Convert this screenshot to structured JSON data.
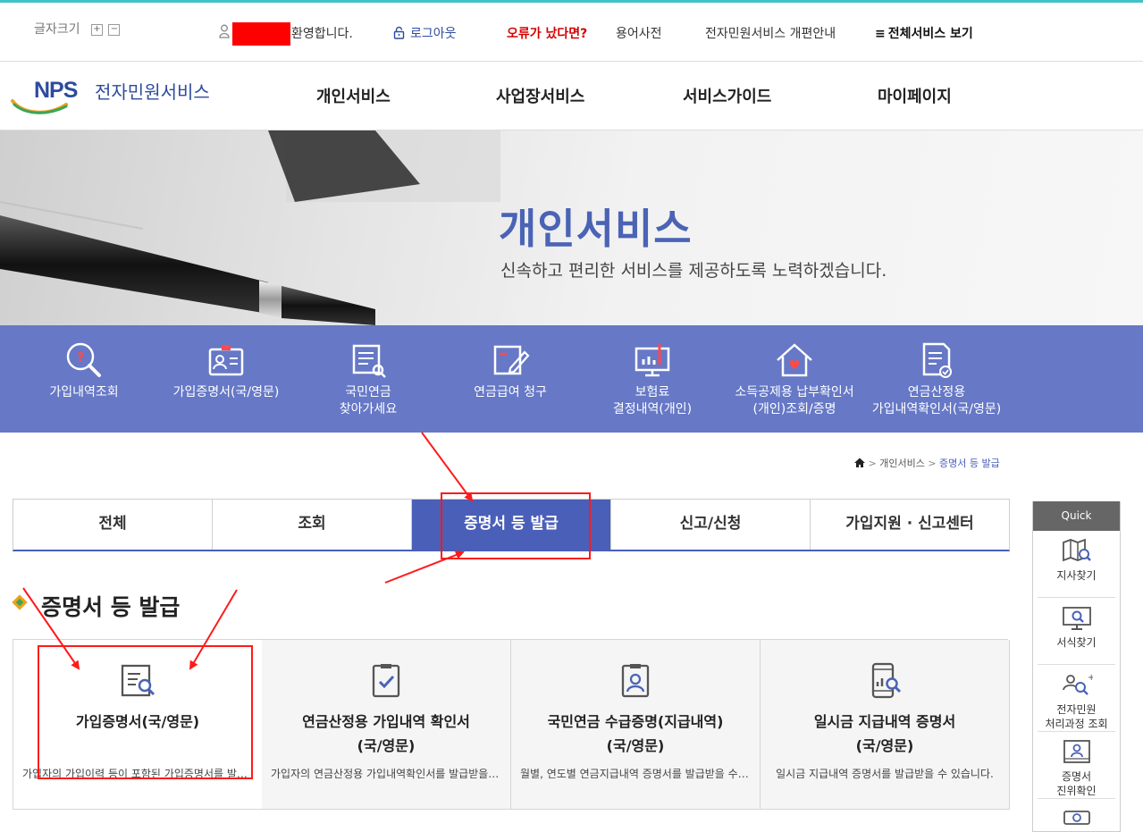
{
  "util": {
    "font_size_label": "글자크기",
    "font_plus": "+",
    "font_minus": "−",
    "welcome": "환영합니다.",
    "logout": "로그아웃",
    "error": "오류가 났다면?",
    "glossary": "용어사전",
    "renewal": "전자민원서비스 개편안내",
    "all_services": "전체서비스 보기",
    "hamburger": "≡"
  },
  "logo": {
    "mark": "NPS",
    "name": "전자민원서비스"
  },
  "nav": [
    "개인서비스",
    "사업장서비스",
    "서비스가이드",
    "마이페이지"
  ],
  "hero": {
    "title": "개인서비스",
    "subtitle": "신속하고 편리한 서비스를 제공하도록 노력하겠습니다."
  },
  "services": [
    {
      "line1": "가입내역조회",
      "line2": "",
      "icon": "search-question-icon"
    },
    {
      "line1": "가입증명서(국/영문)",
      "line2": "",
      "icon": "id-card-icon"
    },
    {
      "line1": "국민연금",
      "line2": "찾아가세요",
      "icon": "document-search-icon"
    },
    {
      "line1": "연금급여 청구",
      "line2": "",
      "icon": "edit-document-icon"
    },
    {
      "line1": "보험료",
      "line2": "결정내역(개인)",
      "icon": "monitor-chart-icon"
    },
    {
      "line1": "소득공제용 납부확인서",
      "line2": "(개인)조회/증명",
      "icon": "house-heart-icon"
    },
    {
      "line1": "연금산정용",
      "line2": "가입내역확인서(국/영문)",
      "icon": "document-check-icon"
    }
  ],
  "breadcrumb": {
    "level1": "개인서비스",
    "level2": "증명서 등 발급",
    "sep": ">"
  },
  "tabs": [
    {
      "label": "전체",
      "active": false
    },
    {
      "label": "조회",
      "active": false
    },
    {
      "label": "증명서 등 발급",
      "active": true
    },
    {
      "label": "신고/신청",
      "active": false
    },
    {
      "label": "가입지원 · 신고센터",
      "active": false
    }
  ],
  "section_title": "증명서 등 발급",
  "cards": [
    {
      "title1": "가입증명서(국/영문)",
      "title2": "",
      "desc": "가입자의 가입이력 등이 포함된 가입증명서를 발급받을 수 있습니다.",
      "icon": "document-search-icon"
    },
    {
      "title1": "연금산정용 가입내역 확인서",
      "title2": "(국/영문)",
      "desc": "가입자의 연금산정용 가입내역확인서를 발급받을 수 있습니다.",
      "icon": "clipboard-check-icon"
    },
    {
      "title1": "국민연금 수급증명(지급내역)",
      "title2": "(국/영문)",
      "desc": "월별, 연도별 연금지급내역 증명서를 발급받을 수 있습니다.",
      "icon": "id-badge-icon"
    },
    {
      "title1": "일시금 지급내역 증명서",
      "title2": "(국/영문)",
      "desc": "일시금 지급내역 증명서를 발급받을 수 있습니다.",
      "icon": "mobile-chart-icon"
    }
  ],
  "quick": {
    "title": "Quick",
    "items": [
      {
        "line1": "지사찾기",
        "line2": "",
        "icon": "map-search-icon"
      },
      {
        "line1": "서식찾기",
        "line2": "",
        "icon": "monitor-search-icon"
      },
      {
        "line1": "전자민원",
        "line2": "처리과정 조회",
        "icon": "people-search-icon"
      },
      {
        "line1": "증명서",
        "line2": "진위확인",
        "icon": "certificate-icon"
      },
      {
        "line1": "",
        "line2": "",
        "icon": "scanner-icon"
      }
    ]
  },
  "colors": {
    "band": "#6678c6",
    "active_tab": "#4a5fb8",
    "hero_title": "#4a63b5",
    "topline": "#3fc3c6",
    "error_text": "#d40000",
    "annotation": "#ff1a1a"
  }
}
